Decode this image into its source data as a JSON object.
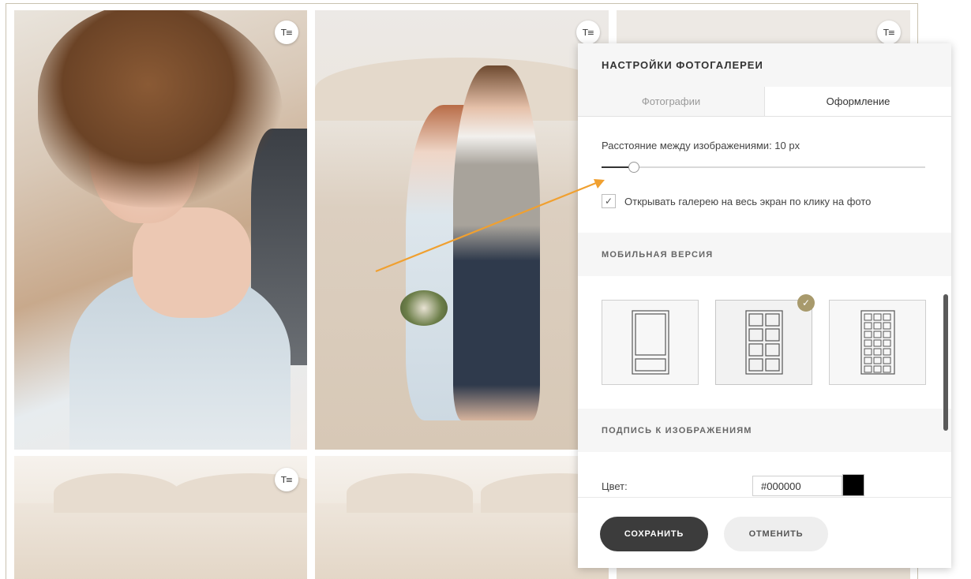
{
  "gallery": {
    "text_icon": "T≡",
    "photos": [
      {
        "id": "photo-1"
      },
      {
        "id": "photo-2"
      },
      {
        "id": "photo-3"
      },
      {
        "id": "photo-4"
      },
      {
        "id": "photo-5"
      },
      {
        "id": "photo-6"
      }
    ]
  },
  "panel": {
    "title": "НАСТРОЙКИ ФОТОГАЛЕРЕИ",
    "tabs": [
      {
        "label": "Фотографии",
        "active": false
      },
      {
        "label": "Оформление",
        "active": true
      }
    ],
    "spacing": {
      "label": "Расстояние между изображениями: 10 px",
      "value": 10,
      "max": 100
    },
    "fullscreen": {
      "label": "Открывать галерею на весь экран по клику на фото",
      "checked": true
    },
    "mobile": {
      "heading": "МОБИЛЬНАЯ ВЕРСИЯ",
      "layouts": [
        "one-column",
        "two-columns",
        "three-columns"
      ],
      "selected": "two-columns"
    },
    "caption": {
      "heading": "ПОДПИСЬ К ИЗОБРАЖЕНИЯМ",
      "color_label": "Цвет:",
      "color_value": "#000000"
    },
    "buttons": {
      "save": "СОХРАНИТЬ",
      "cancel": "ОТМЕНИТЬ"
    }
  },
  "colors": {
    "accent_arrow": "#f0a030",
    "badge": "#a89a6c",
    "save_button": "#3c3c3c"
  }
}
